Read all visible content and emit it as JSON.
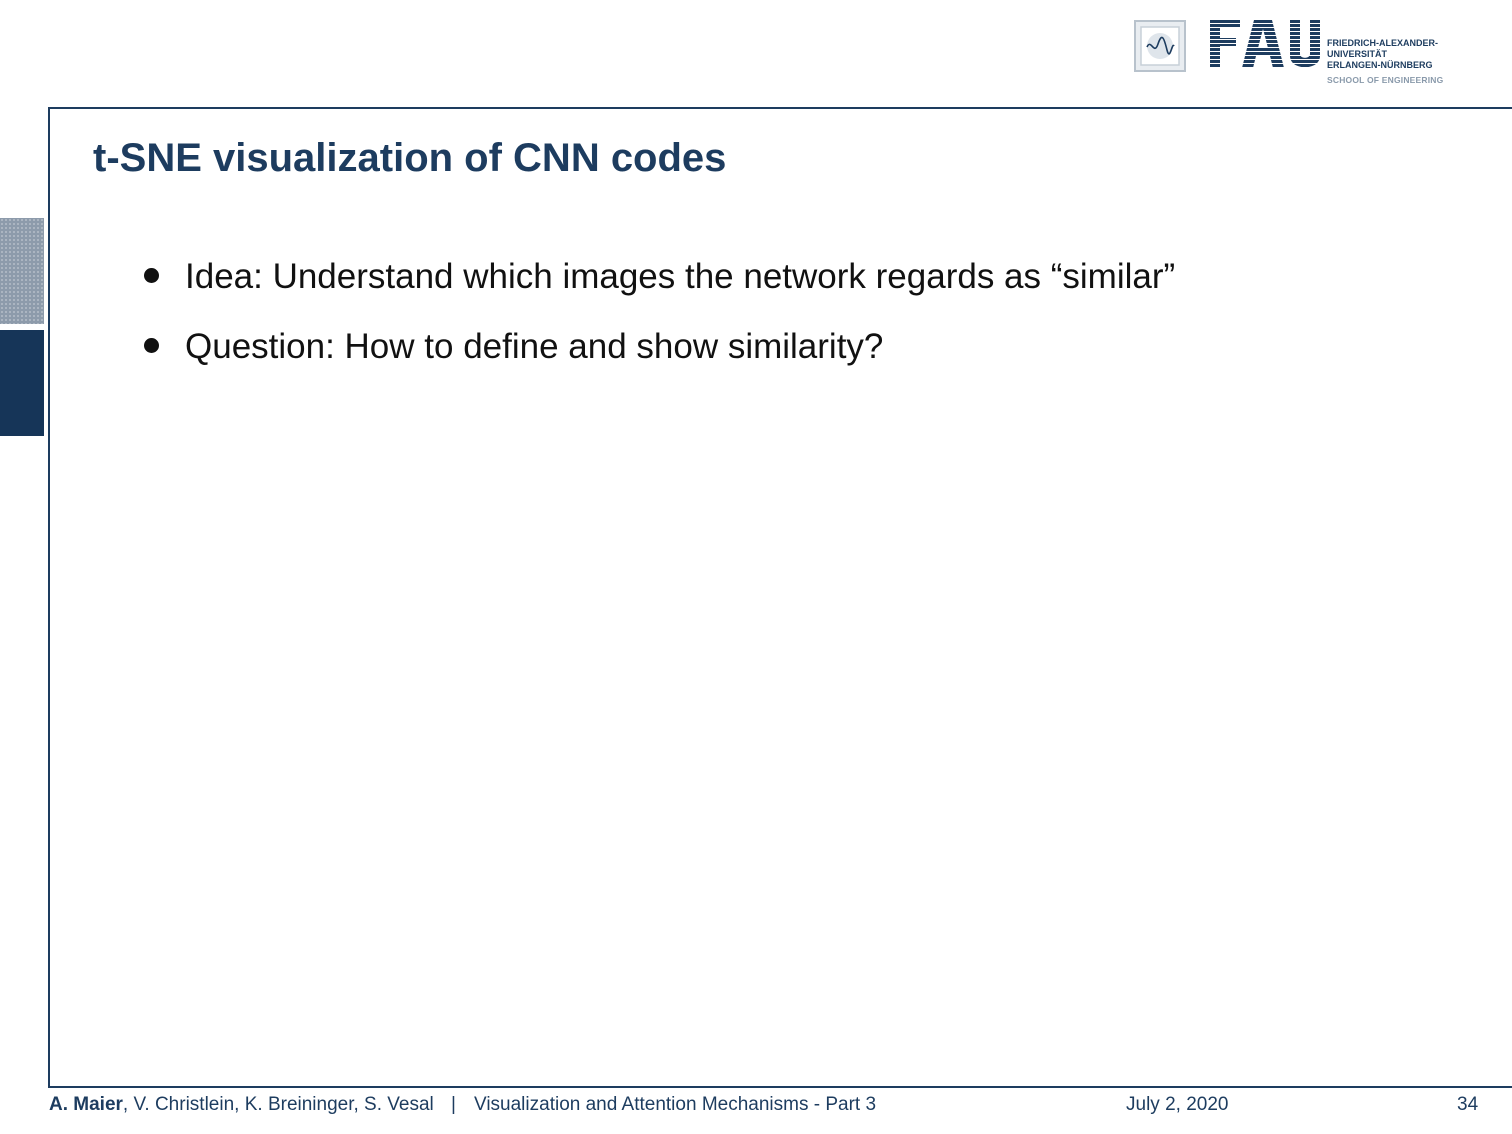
{
  "header": {
    "logo_name_lines": [
      "FRIEDRICH-ALEXANDER-",
      "UNIVERSITÄT",
      "ERLANGEN-NÜRNBERG"
    ],
    "logo_school": "SCHOOL OF ENGINEERING",
    "logo_mark": "FAU"
  },
  "slide": {
    "title": "t-SNE visualization of CNN codes",
    "bullets": [
      "Idea: Understand which images the network regards as “similar”",
      "Question: How to define and show similarity?"
    ]
  },
  "footer": {
    "lead_author": "A. Maier",
    "other_authors": ", V. Christlein, K. Breininger, S. Vesal",
    "separator": "|",
    "lecture": "Visualization and Attention Mechanisms - Part 3",
    "date": "July 2, 2020",
    "page": "34"
  },
  "colors": {
    "primary": "#1d3c5f",
    "tab_gray": "#8d9bab",
    "tab_dark": "#163558"
  }
}
